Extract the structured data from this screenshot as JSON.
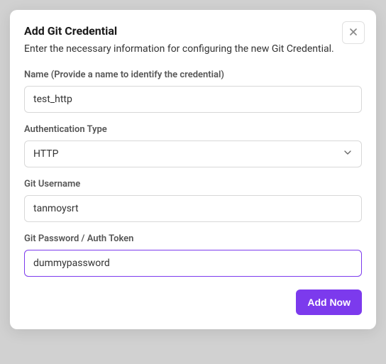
{
  "modal": {
    "title": "Add Git Credential",
    "subtitle": "Enter the necessary information for configuring the new Git Credential."
  },
  "fields": {
    "name": {
      "label": "Name (Provide a name to identify the credential)",
      "value": "test_http"
    },
    "auth_type": {
      "label": "Authentication Type",
      "value": "HTTP"
    },
    "username": {
      "label": "Git Username",
      "value": "tanmoysrt"
    },
    "password": {
      "label": "Git Password / Auth Token",
      "value": "dummypassword"
    }
  },
  "footer": {
    "submit_label": "Add Now"
  }
}
